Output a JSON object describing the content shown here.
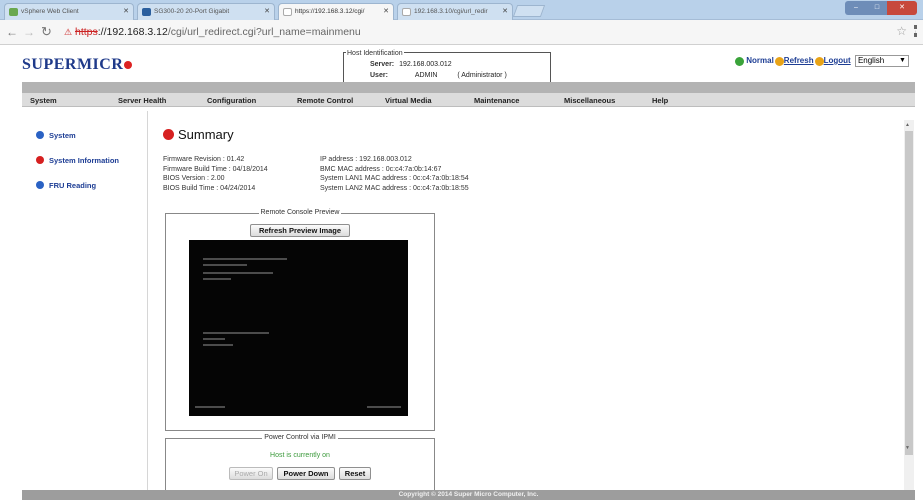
{
  "browser": {
    "tabs": [
      {
        "label": "vSphere Web Client"
      },
      {
        "label": "SG300-20 20-Port Gigabit"
      },
      {
        "label": "https://192.168.3.12/cgi/"
      },
      {
        "label": "192.168.3.10/cgi/url_redir"
      }
    ],
    "url_protocol": "https",
    "url_host": "://192.168.3.12",
    "url_path": "/cgi/url_redirect.cgi?url_name=mainmenu"
  },
  "brand": {
    "logo_text": "SUPERMICR"
  },
  "host_identification": {
    "legend": "Host Identification",
    "server_label": "Server:",
    "server_value": "192.168.003.012",
    "user_label": "User:",
    "user_value": "ADMIN",
    "user_role": "( Administrator )"
  },
  "top_actions": {
    "mode": "Normal",
    "refresh": "Refresh",
    "logout": "Logout",
    "language": "English"
  },
  "main_nav": [
    "System",
    "Server Health",
    "Configuration",
    "Remote Control",
    "Virtual Media",
    "Maintenance",
    "Miscellaneous",
    "Help"
  ],
  "sidebar": {
    "items": [
      {
        "label": "System"
      },
      {
        "label": "System Information"
      },
      {
        "label": "FRU Reading"
      }
    ]
  },
  "summary": {
    "title": "Summary",
    "left": [
      "Firmware Revision : 01.42",
      "Firmware Build Time : 04/18/2014",
      "BIOS Version : 2.00",
      "BIOS Build Time : 04/24/2014"
    ],
    "right": [
      "IP address : 192.168.003.012",
      "BMC MAC address : 0c:c4:7a:0b:14:67",
      "System LAN1 MAC address : 0c:c4:7a:0b:18:54",
      "System LAN2 MAC address : 0c:c4:7a:0b:18:55"
    ]
  },
  "remote_console": {
    "legend": "Remote Console Preview",
    "refresh_button": "Refresh Preview Image"
  },
  "power_control": {
    "legend": "Power Control via IPMI",
    "status": "Host is currently on",
    "power_on": "Power On",
    "power_down": "Power Down",
    "reset": "Reset"
  },
  "footer": {
    "copyright": "Copyright © 2014 Super Micro Computer, Inc."
  },
  "colors": {
    "accent_blue": "#1d3d94",
    "status_red": "#d62020",
    "status_green": "#3c9a3c"
  }
}
